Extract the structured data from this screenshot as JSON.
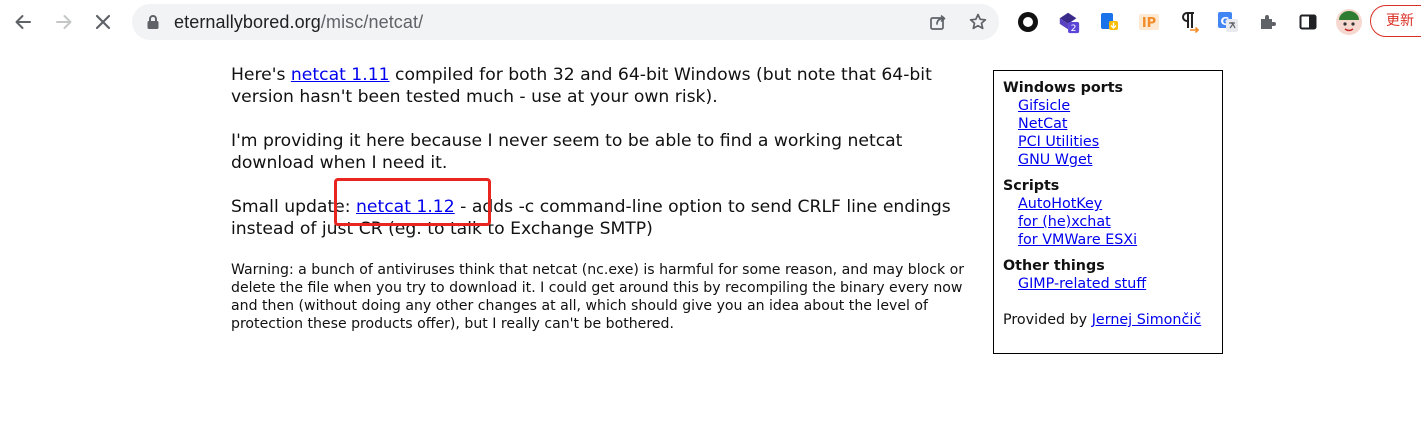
{
  "browser": {
    "url_host": "eternallybored.org",
    "url_path": "/misc/netcat/",
    "update_label": "更新",
    "extension_badge_count": "2",
    "extension_ip_label": "IP",
    "accent_color": "#d93025"
  },
  "icons": {
    "back": "back-arrow-icon",
    "forward": "forward-arrow-icon",
    "stop": "stop-loading-icon",
    "lock": "lock-icon",
    "share": "share-icon",
    "star": "bookmark-star-icon",
    "extensions": "puzzle-icon",
    "sidepanel": "side-panel-icon"
  },
  "main": {
    "p1_prefix": "Here's ",
    "p1_link": "netcat 1.11",
    "p1_suffix": " compiled for both 32 and 64-bit Windows (but note that 64-bit version hasn't been tested much - use at your own risk).",
    "p2": "I'm providing it here because I never seem to be able to find a working netcat download when I need it.",
    "p3_prefix": "Small update: ",
    "p3_link": "netcat 1.12",
    "p3_suffix": " - adds -c command-line option to send CRLF line endings instead of just CR (eg. to talk to Exchange SMTP)",
    "warning": "Warning: a bunch of antiviruses think that netcat (nc.exe) is harmful for some reason, and may block or delete the file when you try to download it. I could get around this by recompiling the binary every now and then (without doing any other changes at all, which should give you an idea about the level of protection these products offer), but I really can't be bothered."
  },
  "sidebar": {
    "sections": [
      {
        "title": "Windows ports",
        "links": [
          "Gifsicle",
          "NetCat",
          "PCI Utilities",
          "GNU Wget"
        ]
      },
      {
        "title": "Scripts",
        "links": [
          "AutoHotKey",
          "for (he)xchat",
          "for VMWare ESXi"
        ]
      },
      {
        "title": "Other things",
        "links": [
          "GIMP-related stuff"
        ]
      }
    ],
    "provided_prefix": "Provided by ",
    "provided_link": "Jernej Simončič"
  }
}
